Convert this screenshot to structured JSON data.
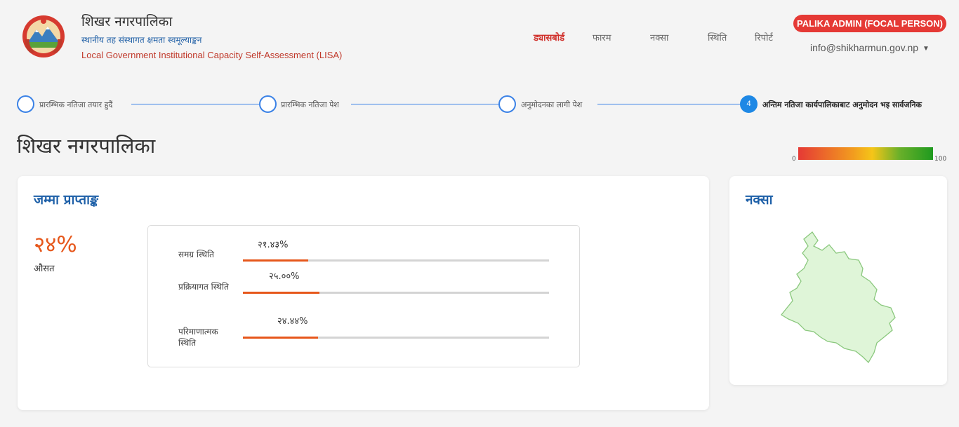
{
  "brand": {
    "title": "शिखर नगरपालिका",
    "subtitle": "स्थानीय तह संस्थागत क्षमता स्वमूल्याङ्कन",
    "english": "Local Government Institutional Capacity Self-Assessment (LISA)"
  },
  "nav": [
    {
      "label": "ड्यासबोर्ड",
      "active": true
    },
    {
      "label": "फारम",
      "active": false
    },
    {
      "label": "नक्सा",
      "active": false
    },
    {
      "label": "स्थिति",
      "active": false
    },
    {
      "label": "रिपोर्ट",
      "active": false
    }
  ],
  "user": {
    "role": "PALIKA ADMIN (FOCAL PERSON)",
    "email": "info@shikharmun.gov.np"
  },
  "stepper": [
    {
      "label": "प्रारम्भिक नतिजा तयार हुदैं",
      "number": ""
    },
    {
      "label": "प्रारम्भिक नतिजा पेश",
      "number": ""
    },
    {
      "label": "अनुमोदनका लागी पेश",
      "number": ""
    },
    {
      "label": "अन्तिम नतिजा कार्यपालिकाबाट अनुमोदन भइ सार्वजनिक",
      "number": "4"
    }
  ],
  "page_title": "शिखर नगरपालिका",
  "scale": {
    "min": "0",
    "max": "100"
  },
  "score_card": {
    "title": "जम्मा प्राप्ताङ्क",
    "value": "२४%",
    "caption": "औसत",
    "rows": [
      {
        "label": "समग्र स्थिति",
        "value": "२१.४३%",
        "percent": 21.43
      },
      {
        "label": "प्रक्रियागत स्थिति",
        "value": "२५.००%",
        "percent": 25.0
      },
      {
        "label": "परिमाणात्मक स्थिति",
        "value": "२४.४४%",
        "percent": 24.44
      }
    ]
  },
  "map_card": {
    "title": "नक्सा"
  },
  "colors": {
    "accent": "#e6571b",
    "nav_active": "#d0302b",
    "badge": "#e53935",
    "step": "#3b82e6",
    "card_title": "#1e60a8"
  }
}
